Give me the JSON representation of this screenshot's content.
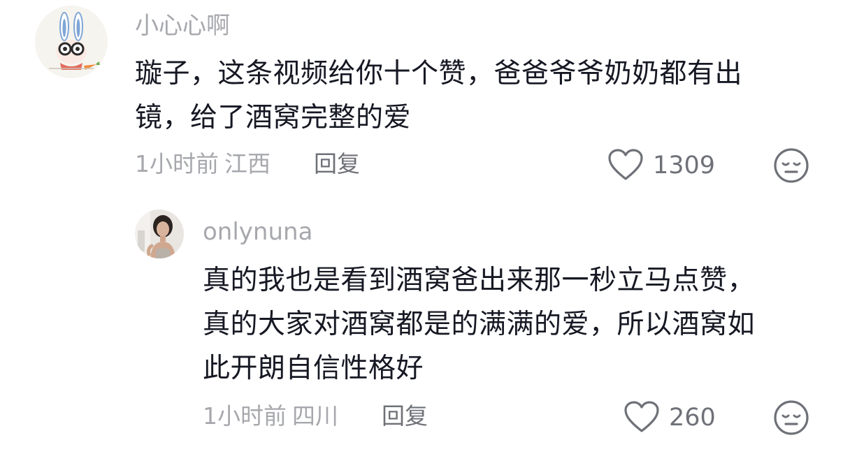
{
  "comments": [
    {
      "username": "小心心啊",
      "text_lines": [
        "璇子，这条视频给你十个赞，爸爸爷爷奶奶都有出",
        "镜，给了酒窝完整的爱"
      ],
      "time": "1小时前",
      "location": "江西",
      "reply_label": "回复",
      "likes": "1309"
    },
    {
      "username": "onlynuna",
      "text_lines": [
        "真的我也是看到酒窝爸出来那一秒立马点赞，",
        "真的大家对酒窝都是的满满的爱，所以酒窝如",
        "此开朗自信性格好"
      ],
      "time": "1小时前",
      "location": "四川",
      "reply_label": "回复",
      "likes": "260"
    }
  ],
  "colors": {
    "text_primary": "#161823",
    "text_secondary": "#a7a8ad",
    "icon": "#6f7178"
  },
  "icons": [
    "heart-outline-icon",
    "neutral-face-icon"
  ]
}
